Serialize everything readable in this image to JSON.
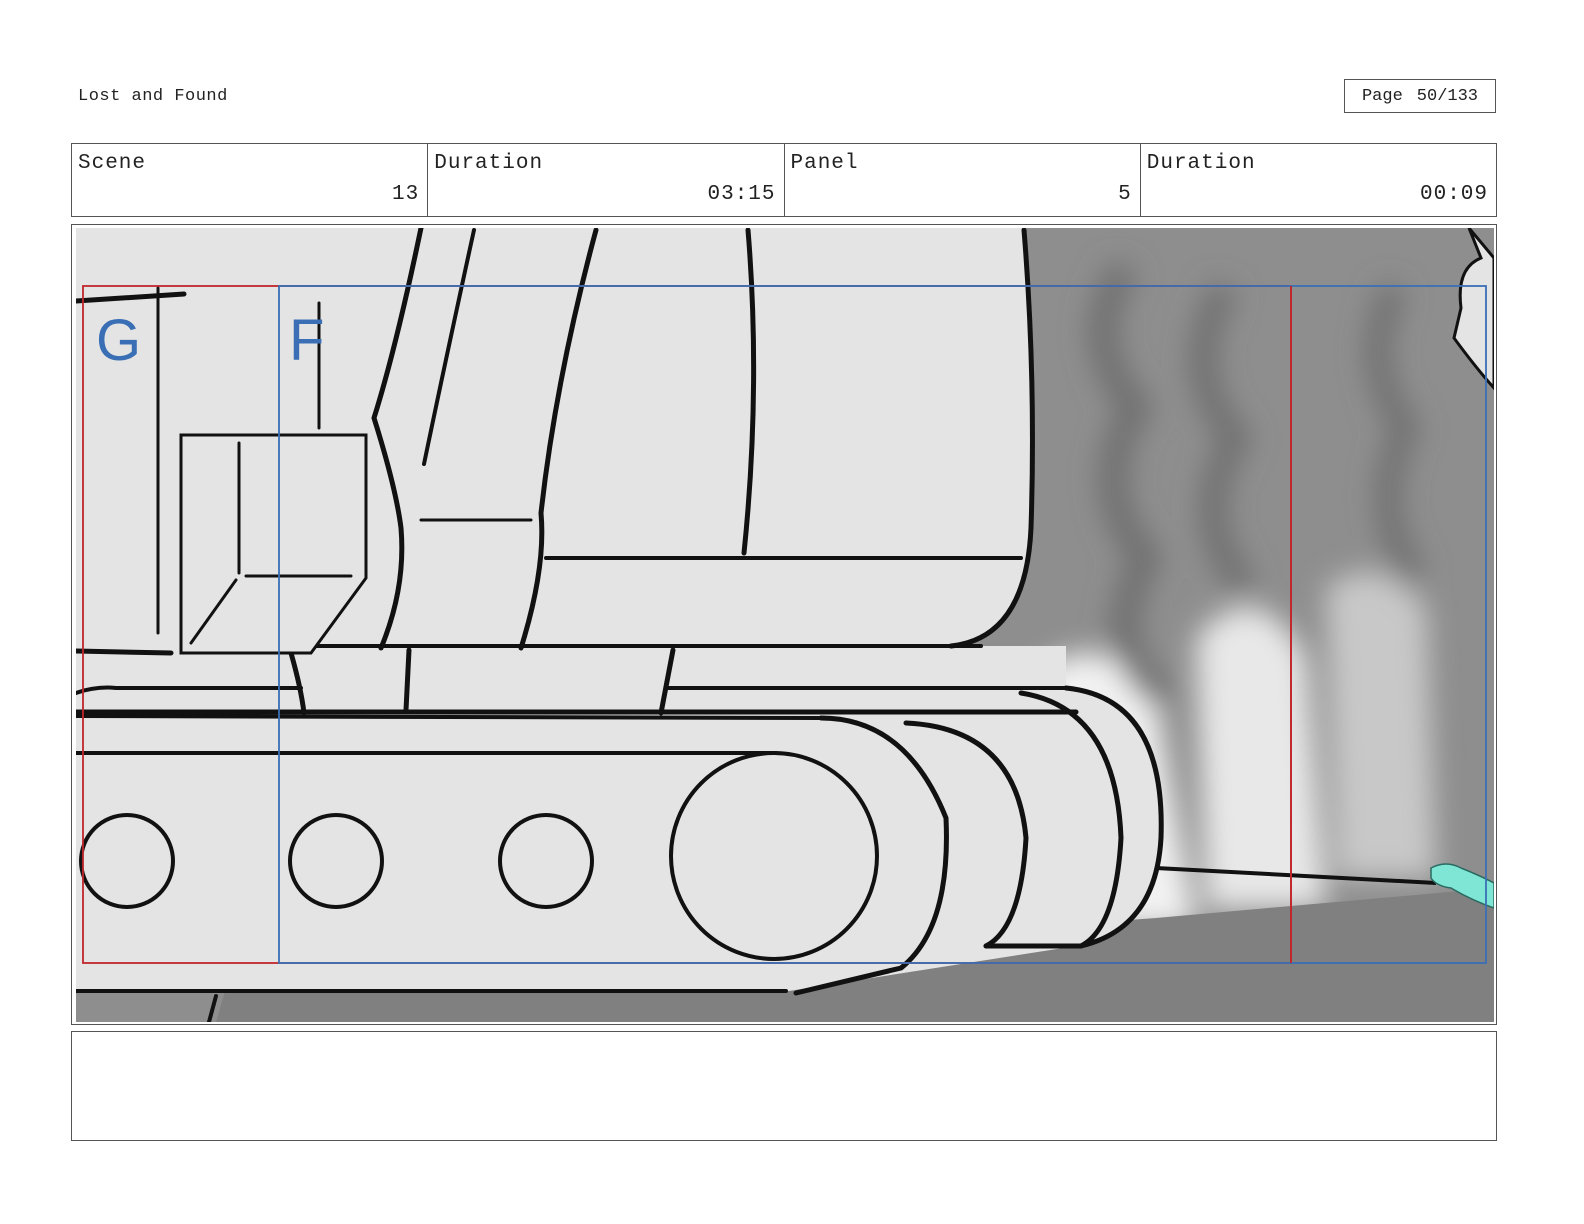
{
  "header": {
    "title": "Lost and Found",
    "page_label": "Page",
    "page_value": "50/133"
  },
  "info": {
    "scene_label": "Scene",
    "scene_value": "13",
    "scene_duration_label": "Duration",
    "scene_duration_value": "03:15",
    "panel_label": "Panel",
    "panel_value": "5",
    "panel_duration_label": "Duration",
    "panel_duration_value": "00:09"
  },
  "panel": {
    "field_label_g": "G",
    "field_label_f": "F",
    "colors": {
      "background_grey": "#9a9a9a",
      "machine_fill": "#e4e4e4",
      "ground": "#808080",
      "frame_red": "#c0262b",
      "frame_blue": "#3a6fb5",
      "hand": "#7fe6d6"
    }
  },
  "notes": {
    "text": ""
  }
}
